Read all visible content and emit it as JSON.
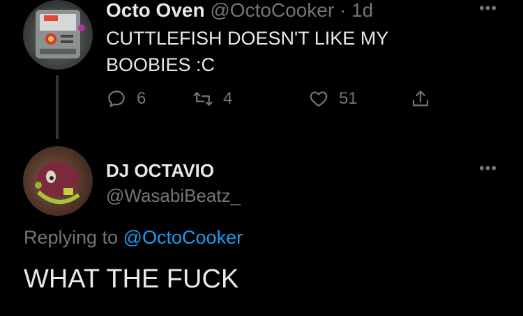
{
  "parent_tweet": {
    "display_name": "Octo Oven",
    "handle": "@OctoCooker",
    "separator": "·",
    "time": "1d",
    "text_line1": "CUTTLEFISH DOESN'T LIKE MY",
    "text_line2": "BOOBIES :C",
    "counts": {
      "replies": "6",
      "retweets": "4",
      "likes": "51"
    }
  },
  "reply_tweet": {
    "display_name": "DJ OCTAVIO",
    "handle": "@WasabiBeatz_",
    "replying_label": "Replying to",
    "replying_mention": "@OctoCooker",
    "text": "WHAT THE FUCK"
  },
  "icons": {
    "more": "more-horizontal-icon",
    "reply": "reply-bubble-icon",
    "retweet": "retweet-icon",
    "like": "heart-icon",
    "share": "share-icon"
  },
  "colors": {
    "background": "#000000",
    "text_primary": "#e7e9ea",
    "text_secondary": "#71767b",
    "link": "#1d9bf0",
    "thread_line": "#333639"
  }
}
